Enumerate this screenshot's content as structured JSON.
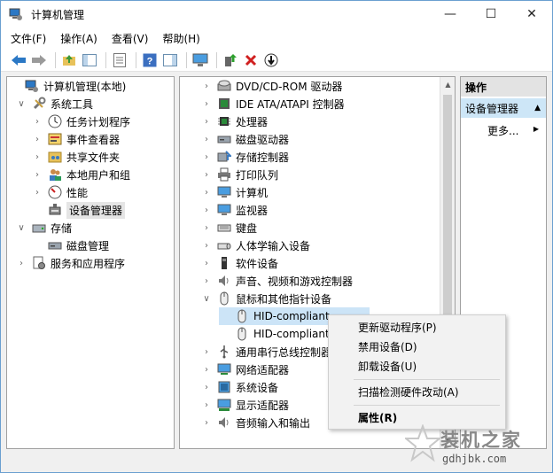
{
  "window": {
    "title": "计算机管理",
    "controls": [
      "—",
      "☐",
      "✕"
    ]
  },
  "menu": [
    "文件(F)",
    "操作(A)",
    "查看(V)",
    "帮助(H)"
  ],
  "toolbar": [
    "back",
    "forward",
    "up-folder",
    "show-tree",
    "properties",
    "help",
    "action-pane",
    "computer",
    "update-driver",
    "uninstall",
    "disable"
  ],
  "left_tree": [
    {
      "label": "计算机管理(本地)",
      "arrow": "",
      "icon": "computer",
      "indent": 0
    },
    {
      "label": "系统工具",
      "arrow": "∨",
      "icon": "tools",
      "indent": 1
    },
    {
      "label": "任务计划程序",
      "arrow": "›",
      "icon": "clock",
      "indent": 2
    },
    {
      "label": "事件查看器",
      "arrow": "›",
      "icon": "event",
      "indent": 2
    },
    {
      "label": "共享文件夹",
      "arrow": "›",
      "icon": "folder",
      "indent": 2
    },
    {
      "label": "本地用户和组",
      "arrow": "›",
      "icon": "users",
      "indent": 2
    },
    {
      "label": "性能",
      "arrow": "›",
      "icon": "perf",
      "indent": 2
    },
    {
      "label": "设备管理器",
      "arrow": "",
      "icon": "devmgr",
      "indent": 2,
      "selected": true
    },
    {
      "label": "存储",
      "arrow": "∨",
      "icon": "storage",
      "indent": 1
    },
    {
      "label": "磁盘管理",
      "arrow": "",
      "icon": "disk",
      "indent": 2
    },
    {
      "label": "服务和应用程序",
      "arrow": "›",
      "icon": "services",
      "indent": 1
    }
  ],
  "device_tree": [
    {
      "label": "DVD/CD-ROM 驱动器",
      "arrow": "›",
      "icon": "dvd",
      "indent": 0
    },
    {
      "label": "IDE ATA/ATAPI 控制器",
      "arrow": "›",
      "icon": "ide",
      "indent": 0
    },
    {
      "label": "处理器",
      "arrow": "›",
      "icon": "cpu",
      "indent": 0
    },
    {
      "label": "磁盘驱动器",
      "arrow": "›",
      "icon": "disk",
      "indent": 0
    },
    {
      "label": "存储控制器",
      "arrow": "›",
      "icon": "storage",
      "indent": 0
    },
    {
      "label": "打印队列",
      "arrow": "›",
      "icon": "printer",
      "indent": 0
    },
    {
      "label": "计算机",
      "arrow": "›",
      "icon": "monitor",
      "indent": 0
    },
    {
      "label": "监视器",
      "arrow": "›",
      "icon": "monitor",
      "indent": 0
    },
    {
      "label": "键盘",
      "arrow": "›",
      "icon": "keyboard",
      "indent": 0
    },
    {
      "label": "人体学输入设备",
      "arrow": "›",
      "icon": "hid",
      "indent": 0
    },
    {
      "label": "软件设备",
      "arrow": "›",
      "icon": "software",
      "indent": 0
    },
    {
      "label": "声音、视频和游戏控制器",
      "arrow": "›",
      "icon": "sound",
      "indent": 0
    },
    {
      "label": "鼠标和其他指针设备",
      "arrow": "∨",
      "icon": "mouse",
      "indent": 0
    },
    {
      "label": "HID-compliant",
      "arrow": "",
      "icon": "mouse",
      "indent": 1,
      "selected": true
    },
    {
      "label": "HID-compliant",
      "arrow": "",
      "icon": "mouse",
      "indent": 1
    },
    {
      "label": "通用串行总线控制器",
      "arrow": "›",
      "icon": "usb",
      "indent": 0
    },
    {
      "label": "网络适配器",
      "arrow": "›",
      "icon": "network",
      "indent": 0
    },
    {
      "label": "系统设备",
      "arrow": "›",
      "icon": "system",
      "indent": 0
    },
    {
      "label": "显示适配器",
      "arrow": "›",
      "icon": "display",
      "indent": 0
    },
    {
      "label": "音频输入和输出",
      "arrow": "›",
      "icon": "sound",
      "indent": 0
    }
  ],
  "actions": {
    "header": "操作",
    "selected": "设备管理器",
    "more": "更多..."
  },
  "context_menu": [
    {
      "label": "更新驱动程序(P)"
    },
    {
      "label": "禁用设备(D)"
    },
    {
      "label": "卸载设备(U)"
    },
    {
      "label": "扫描检测硬件改动(A)",
      "sep_before": true
    },
    {
      "label": "属性(R)",
      "bold": true,
      "sep_before": true
    }
  ],
  "watermark": {
    "text": "装机之家",
    "url": "gdhjbk.com"
  },
  "colors": {
    "accent": "#cde6f7",
    "selection": "#e5e5e5",
    "blue_icon": "#2b78c5"
  }
}
